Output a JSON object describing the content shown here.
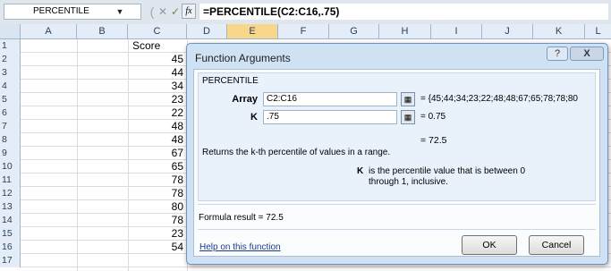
{
  "formula_bar": {
    "name_box": "PERCENTILE",
    "cancel_symbol": "✕",
    "enter_symbol": "✓",
    "fx_label": "fx",
    "formula": "=PERCENTILE(C2:C16,.75)"
  },
  "grid": {
    "columns": [
      "A",
      "B",
      "C",
      "D",
      "E",
      "F",
      "G",
      "H",
      "I",
      "J",
      "K",
      "L"
    ],
    "selected_column": "E",
    "rows": [
      {
        "num": "1",
        "c": "Score"
      },
      {
        "num": "2",
        "c": "45"
      },
      {
        "num": "3",
        "c": "44"
      },
      {
        "num": "4",
        "c": "34"
      },
      {
        "num": "5",
        "c": "23"
      },
      {
        "num": "6",
        "c": "22"
      },
      {
        "num": "7",
        "c": "48"
      },
      {
        "num": "8",
        "c": "48"
      },
      {
        "num": "9",
        "c": "67"
      },
      {
        "num": "10",
        "c": "65"
      },
      {
        "num": "11",
        "c": "78"
      },
      {
        "num": "12",
        "c": "78"
      },
      {
        "num": "13",
        "c": "80"
      },
      {
        "num": "14",
        "c": "78"
      },
      {
        "num": "15",
        "c": "23"
      },
      {
        "num": "16",
        "c": "54"
      },
      {
        "num": "17",
        "c": ""
      }
    ]
  },
  "dialog": {
    "title": "Function Arguments",
    "help_symbol": "?",
    "close_symbol": "X",
    "function_name": "PERCENTILE",
    "args": [
      {
        "label": "Array",
        "value": "C2:C16",
        "result": "= {45;44;34;23;22;48;48;67;65;78;78;80"
      },
      {
        "label": "K",
        "value": ".75",
        "result": "= 0.75"
      }
    ],
    "result_line": "= 72.5",
    "description": "Returns the k-th percentile of values in a range.",
    "arg_desc_label": "K",
    "arg_desc_text": "is the percentile value that is between 0 through 1, inclusive.",
    "formula_result": "Formula result =   72.5",
    "help_link": "Help on this function",
    "ok_label": "OK",
    "cancel_label": "Cancel"
  },
  "colors": {
    "dialog_bg": "#cfe2f3",
    "selected_header": "#f8d78b"
  }
}
